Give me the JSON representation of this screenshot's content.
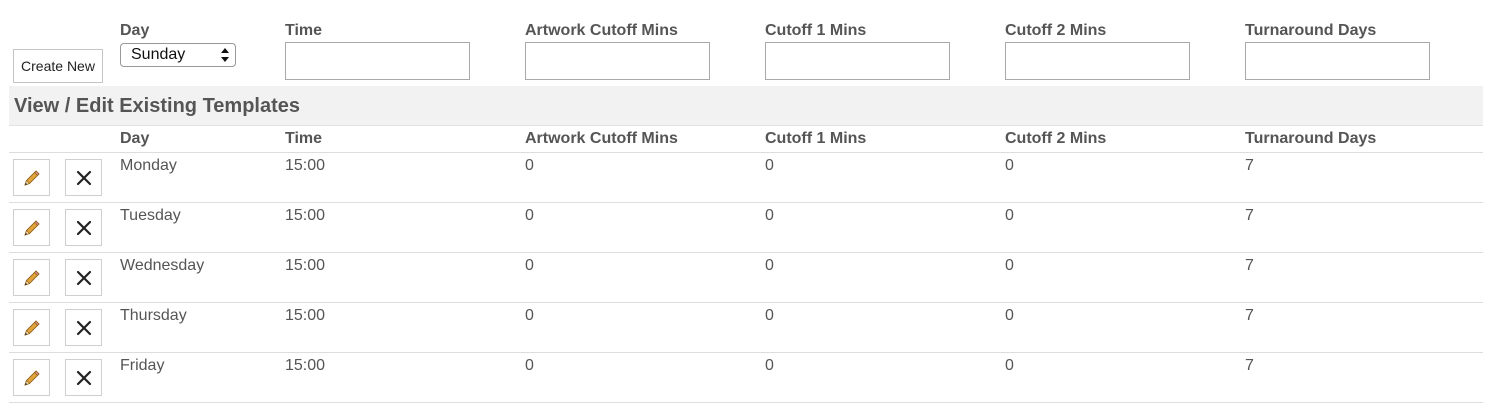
{
  "create_form": {
    "create_button_label": "Create New",
    "labels": {
      "day": "Day",
      "time": "Time",
      "artwork_cutoff": "Artwork Cutoff Mins",
      "cutoff1": "Cutoff 1 Mins",
      "cutoff2": "Cutoff 2 Mins",
      "turnaround": "Turnaround Days"
    },
    "day_selected": "Sunday",
    "values": {
      "time": "",
      "artwork_cutoff": "",
      "cutoff1": "",
      "cutoff2": "",
      "turnaround": ""
    }
  },
  "section": {
    "title": "View / Edit Existing Templates"
  },
  "table": {
    "headers": {
      "day": "Day",
      "time": "Time",
      "artwork_cutoff": "Artwork Cutoff Mins",
      "cutoff1": "Cutoff 1 Mins",
      "cutoff2": "Cutoff 2 Mins",
      "turnaround": "Turnaround Days"
    },
    "rows": [
      {
        "day": "Monday",
        "time": "15:00",
        "artwork_cutoff": "0",
        "cutoff1": "0",
        "cutoff2": "0",
        "turnaround": "7"
      },
      {
        "day": "Tuesday",
        "time": "15:00",
        "artwork_cutoff": "0",
        "cutoff1": "0",
        "cutoff2": "0",
        "turnaround": "7"
      },
      {
        "day": "Wednesday",
        "time": "15:00",
        "artwork_cutoff": "0",
        "cutoff1": "0",
        "cutoff2": "0",
        "turnaround": "7"
      },
      {
        "day": "Thursday",
        "time": "15:00",
        "artwork_cutoff": "0",
        "cutoff1": "0",
        "cutoff2": "0",
        "turnaround": "7"
      },
      {
        "day": "Friday",
        "time": "15:00",
        "artwork_cutoff": "0",
        "cutoff1": "0",
        "cutoff2": "0",
        "turnaround": "7"
      }
    ]
  },
  "icons": {
    "edit": "pencil-icon",
    "delete": "close-icon"
  },
  "colors": {
    "text": "#555555",
    "header_bg": "#f2f2f2",
    "border": "#dddddd"
  }
}
